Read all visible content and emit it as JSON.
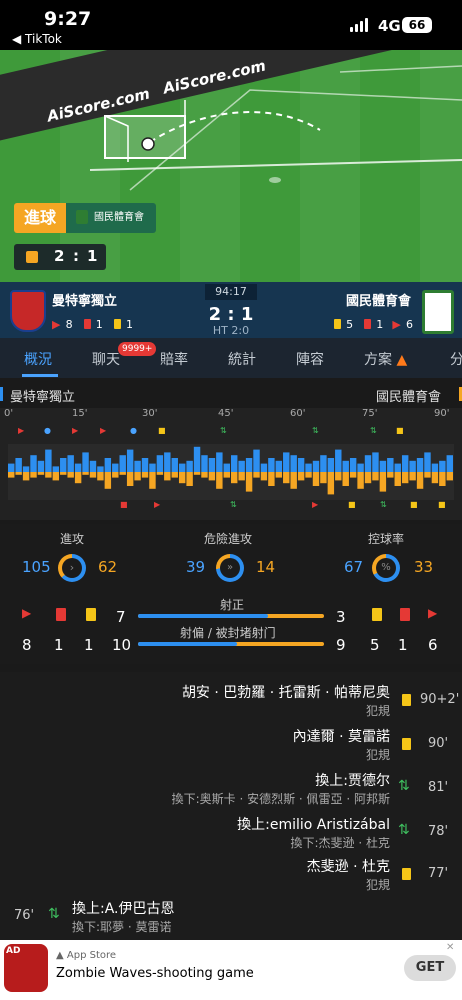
{
  "status_bar": {
    "time": "9:27",
    "back_app": "◀ TikTok",
    "network": "4G",
    "battery": "66"
  },
  "field": {
    "brand_1": "AiScore.com",
    "brand_2": "AiScore.com",
    "goal_label": "進球",
    "goal_team": "國民體育會",
    "live_score_home": "2",
    "live_score_sep": ":",
    "live_score_away": "1"
  },
  "match": {
    "home": {
      "name": "曼特寧獨立",
      "flags": "8",
      "red": "1",
      "yellow": "1"
    },
    "away": {
      "name": "國民體育會",
      "yellow": "5",
      "red": "1",
      "flags": "6"
    },
    "clock": "94:17",
    "score": "2 : 1",
    "ht": "HT 2:0"
  },
  "tabs": [
    {
      "label": "概況"
    },
    {
      "label": "聊天"
    },
    {
      "label": "賠率"
    },
    {
      "label": "統計"
    },
    {
      "label": "陣容"
    },
    {
      "label": "方案"
    },
    {
      "label": "分"
    }
  ],
  "chat_badge": "9999+",
  "timeline": {
    "home_label": "曼特寧獨立",
    "away_label": "國民體育會",
    "ticks": [
      "0'",
      "15'",
      "30'",
      "45'",
      "60'",
      "75'",
      "90'"
    ],
    "home_bars": [
      0.3,
      0.5,
      0.2,
      0.6,
      0.4,
      0.8,
      0.2,
      0.5,
      0.6,
      0.3,
      0.7,
      0.4,
      0.2,
      0.5,
      0.3,
      0.6,
      0.8,
      0.4,
      0.5,
      0.3,
      0.6,
      0.7,
      0.5,
      0.3,
      0.4,
      0.9,
      0.6,
      0.5,
      0.7,
      0.3,
      0.6,
      0.4,
      0.5,
      0.8,
      0.3,
      0.5,
      0.4,
      0.7,
      0.6,
      0.5,
      0.3,
      0.4,
      0.6,
      0.5,
      0.8,
      0.4,
      0.5,
      0.3,
      0.6,
      0.7,
      0.4,
      0.5,
      0.3,
      0.6,
      0.4,
      0.5,
      0.7,
      0.3,
      0.4,
      0.6
    ],
    "away_bars": [
      0.2,
      0.1,
      0.3,
      0.2,
      0.1,
      0.2,
      0.3,
      0.1,
      0.2,
      0.4,
      0.1,
      0.2,
      0.3,
      0.6,
      0.2,
      0.1,
      0.5,
      0.3,
      0.2,
      0.6,
      0.1,
      0.3,
      0.2,
      0.4,
      0.5,
      0.1,
      0.2,
      0.3,
      0.6,
      0.2,
      0.4,
      0.3,
      0.7,
      0.2,
      0.3,
      0.5,
      0.2,
      0.4,
      0.6,
      0.3,
      0.2,
      0.5,
      0.4,
      0.8,
      0.3,
      0.5,
      0.2,
      0.6,
      0.4,
      0.3,
      0.7,
      0.2,
      0.5,
      0.4,
      0.3,
      0.6,
      0.2,
      0.4,
      0.5,
      0.3
    ]
  },
  "stats": {
    "attack": {
      "label": "進攻",
      "home": "105",
      "away": "62"
    },
    "danger": {
      "label": "危險進攻",
      "home": "39",
      "away": "14"
    },
    "possession": {
      "label": "控球率",
      "home": "67",
      "away": "33",
      "icon": "%"
    },
    "home_cards": {
      "corners": "8",
      "red": "1",
      "yellow": "1"
    },
    "away_cards": {
      "yellow": "5",
      "red": "1",
      "corners": "6"
    },
    "on_target": {
      "label": "射正",
      "home": "7",
      "away": "3"
    },
    "off_target": {
      "label": "射偏 / 被封堵射门",
      "home": "10",
      "away": "9"
    }
  },
  "events": [
    {
      "main": "胡安 · 巴勃羅 · 托雷斯 · 帕蒂尼奥",
      "sub": "犯規",
      "minute": "90+2'",
      "type": "yellow"
    },
    {
      "main": "內達爾 · 莫雷諾",
      "sub": "犯規",
      "minute": "90'",
      "type": "yellow"
    },
    {
      "main": "換上:贾德尔",
      "sub": "換下:奥斯卡 · 安德烈斯 · 佩雷亞 · 阿邦斯",
      "minute": "81'",
      "type": "sub"
    },
    {
      "main": "換上:emilio Aristizábal",
      "sub": "換下:杰斐逊 · 杜克",
      "minute": "78'",
      "type": "sub"
    },
    {
      "main": "杰斐逊 · 杜克",
      "sub": "犯規",
      "minute": "77'",
      "type": "yellow"
    },
    {
      "main": "換上:A.伊巴古恩",
      "sub": "換下:耶夢 · 莫雷诺",
      "minute": "76'",
      "type": "sub"
    }
  ],
  "ad": {
    "store": "App Store",
    "title": "Zombie Waves-shooting game",
    "cta": "GET",
    "ad_tag": "AD"
  },
  "colors": {
    "home": "#2d8ff0",
    "away": "#f5a623",
    "accent": "#4aa3ff"
  }
}
